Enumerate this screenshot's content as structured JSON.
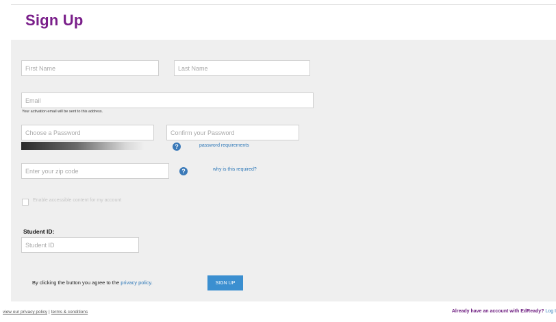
{
  "page": {
    "title": "Sign Up"
  },
  "form": {
    "first_name": {
      "placeholder": "First Name",
      "value": ""
    },
    "last_name": {
      "placeholder": "Last Name",
      "value": ""
    },
    "email": {
      "placeholder": "Email",
      "value": "",
      "hint": "Your activation email will be sent to this address."
    },
    "password": {
      "placeholder": "Choose a Password",
      "value": ""
    },
    "confirm_password": {
      "placeholder": "Confirm your Password",
      "value": ""
    },
    "password_requirements_link": "password requirements",
    "zip": {
      "placeholder": "Enter your zip code",
      "value": ""
    },
    "why_required_link": "why is this required?",
    "accessible_checkbox_label": "Enable accessible content for my account",
    "student_id": {
      "label": "Student ID:",
      "placeholder": "Student ID",
      "value": ""
    },
    "agree_text": "By clicking the button you agree to the",
    "privacy_policy_link": "privacy policy.",
    "signup_button": "SIGN UP",
    "help_icon_glyph": "?"
  },
  "footer": {
    "privacy_link": "view our privacy policy",
    "separator": "|",
    "terms_link": "terms & conditions",
    "account_question": "Already have an account with EdReady?",
    "login_link": "Log I"
  },
  "colors": {
    "title": "#7a1f8a",
    "panel_background": "#efefef",
    "link": "#2e78b8",
    "button": "#3b8fd0",
    "help_icon": "#3a79b8"
  }
}
